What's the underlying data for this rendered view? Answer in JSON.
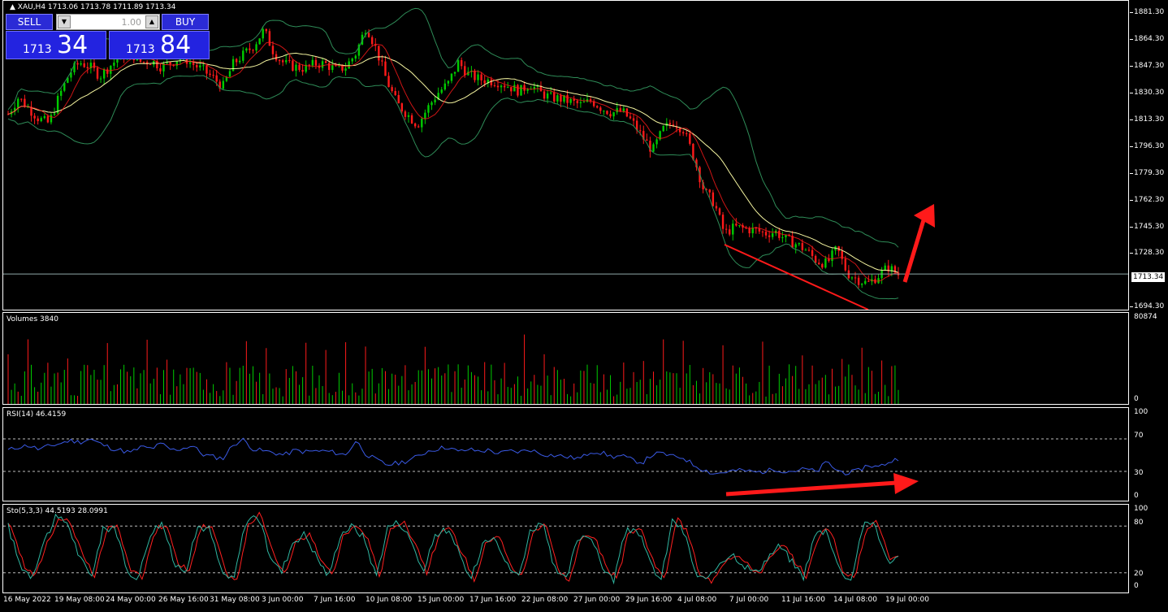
{
  "chart_header": {
    "symbol_line": "▲ XAU,H4  1713.06 1713.78 1711.89 1713.34"
  },
  "trade_panel": {
    "sell_label": "SELL",
    "buy_label": "BUY",
    "volume": "1.00",
    "sell_price_small": "1713",
    "sell_price_big": "34",
    "buy_price_small": "1713",
    "buy_price_big": "84"
  },
  "price_axis": {
    "labels": [
      "1881.30",
      "1864.30",
      "1847.30",
      "1830.30",
      "1813.30",
      "1796.30",
      "1779.30",
      "1762.30",
      "1745.30",
      "1728.30",
      "1694.30"
    ],
    "current": "1713.34"
  },
  "volumes": {
    "title": "Volumes 3840",
    "axis_max": "80874",
    "axis_min": "0"
  },
  "rsi": {
    "title": "RSI(14) 46.4159",
    "levels": [
      "100",
      "70",
      "30",
      "0"
    ]
  },
  "stoch": {
    "title": "Sto(5,3,3) 44.5193 28.0991",
    "levels": [
      "100",
      "80",
      "20",
      "0"
    ]
  },
  "time_axis": [
    "16 May 2022",
    "19 May 08:00",
    "24 May 00:00",
    "26 May 16:00",
    "31 May 08:00",
    "3 Jun 00:00",
    "7 Jun 16:00",
    "10 Jun 08:00",
    "15 Jun 00:00",
    "17 Jun 16:00",
    "22 Jun 08:00",
    "27 Jun 00:00",
    "29 Jun 16:00",
    "4 Jul 08:00",
    "7 Jul 00:00",
    "11 Jul 16:00",
    "14 Jul 08:00",
    "19 Jul 00:00"
  ],
  "colors": {
    "bull": "#00cc00",
    "bear": "#ff1a1a",
    "rsi": "#3a5ae6",
    "sto_main": "#2fb5a0",
    "sto_signal": "#ff2020",
    "bands": "#2e8b57",
    "ma": "#f5f5a0",
    "annotation": "#ff1a1a"
  },
  "chart_data": {
    "type": "candlestick",
    "symbol": "XAU",
    "timeframe": "H4",
    "ylim": [
      1690,
      1888
    ],
    "close_path": [
      1818,
      1829,
      1822,
      1815,
      1812,
      1830,
      1845,
      1852,
      1849,
      1843,
      1850,
      1856,
      1858,
      1852,
      1853,
      1849,
      1852,
      1856,
      1851,
      1847,
      1842,
      1836,
      1851,
      1857,
      1863,
      1873,
      1858,
      1851,
      1849,
      1848,
      1851,
      1851,
      1847,
      1849,
      1858,
      1876,
      1860,
      1840,
      1825,
      1818,
      1811,
      1822,
      1832,
      1838,
      1852,
      1844,
      1841,
      1840,
      1839,
      1836,
      1833,
      1838,
      1832,
      1829,
      1828,
      1826,
      1824,
      1827,
      1822,
      1819,
      1820,
      1813,
      1803,
      1794,
      1808,
      1813,
      1808,
      1790,
      1768,
      1760,
      1740,
      1744,
      1743,
      1742,
      1740,
      1741,
      1736,
      1733,
      1729,
      1722,
      1720,
      1730,
      1714,
      1710,
      1707,
      1712,
      1718,
      1713
    ],
    "rsi_path": [
      56,
      60,
      62,
      57,
      61,
      64,
      68,
      66,
      70,
      64,
      59,
      56,
      53,
      60,
      58,
      64,
      56,
      58,
      62,
      51,
      48,
      46,
      63,
      69,
      57,
      55,
      53,
      50,
      56,
      54,
      55,
      55,
      53,
      50,
      68,
      51,
      44,
      38,
      40,
      43,
      48,
      55,
      58,
      60,
      54,
      57,
      55,
      56,
      52,
      55,
      54,
      57,
      52,
      50,
      49,
      47,
      46,
      55,
      53,
      48,
      49,
      44,
      41,
      51,
      52,
      48,
      47,
      38,
      32,
      27,
      29,
      31,
      31,
      29,
      30,
      33,
      30,
      31,
      33,
      29,
      42,
      31,
      28,
      30,
      38,
      35,
      41,
      46
    ],
    "sto_path": [
      80,
      30,
      15,
      60,
      90,
      85,
      40,
      15,
      75,
      80,
      20,
      15,
      72,
      85,
      30,
      25,
      80,
      75,
      20,
      10,
      85,
      95,
      45,
      20,
      60,
      70,
      40,
      15,
      70,
      80,
      65,
      15,
      80,
      85,
      60,
      20,
      70,
      75,
      45,
      10,
      60,
      70,
      30,
      15,
      75,
      85,
      25,
      10,
      65,
      70,
      30,
      10,
      72,
      78,
      35,
      10,
      90,
      70,
      15,
      10,
      35,
      45,
      30,
      20,
      40,
      55,
      35,
      15,
      70,
      75,
      25,
      10,
      80,
      85,
      35,
      40
    ]
  }
}
